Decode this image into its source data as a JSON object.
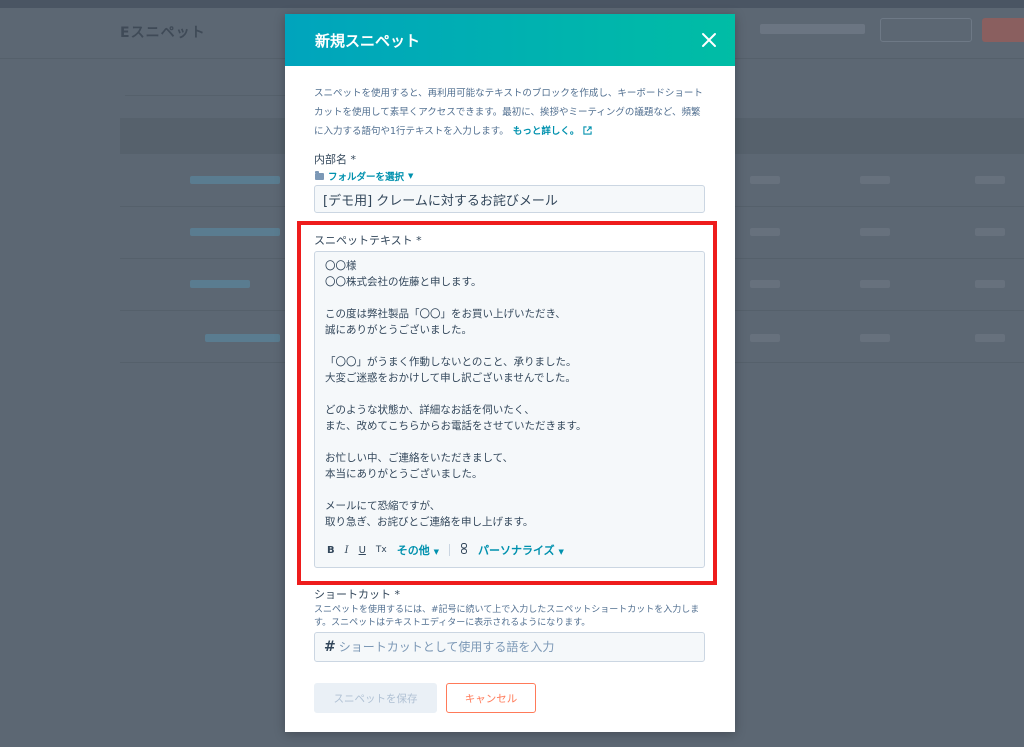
{
  "background": {
    "title": "Eスニペット"
  },
  "modal": {
    "title": "新規スニペット",
    "intro_text": "スニペットを使用すると、再利用可能なテキストのブロックを作成し、キーボードショートカットを使用して素早くアクセスできます。最初に、挨拶やミーティングの議題など、頻繁に入力する語句や1行テキストを入力します。",
    "learn_more": "もっと詳しく。",
    "internal_name_label": "内部名 *",
    "folder_select": "フォルダーを選択",
    "internal_name_value": "[デモ用] クレームに対するお詫びメール",
    "snippet_text_label": "スニペットテキスト *",
    "snippet_text": "〇〇様\n〇〇株式会社の佐藤と申します。\n\nこの度は弊社製品「〇〇」をお買い上げいただき、\n誠にありがとうございました。\n\n「〇〇」がうまく作動しないとのこと、承りました。\n大変ご迷惑をおかけして申し訳ございませんでした。\n\nどのような状態か、詳細なお話を伺いたく、\nまた、改めてこちらからお電話をさせていただきます。\n\nお忙しい中、ご連絡をいただきまして、\n本当にありがとうございました。\n\nメールにて恐縮ですが、\n取り急ぎ、お詫びとご連絡を申し上げます。",
    "toolbar": {
      "bold": "B",
      "italic": "I",
      "underline": "U",
      "clear_format": "Tx",
      "more": "その他",
      "personalize": "パーソナライズ"
    },
    "shortcut_label": "ショートカット *",
    "shortcut_help": "スニペットを使用するには、#記号に続いて上で入力したスニペットショートカットを入力します。スニペットはテキストエディターに表示されるようになります。",
    "shortcut_placeholder": "ショートカットとして使用する語を入力",
    "save_button": "スニペットを保存",
    "cancel_button": "キャンセル"
  },
  "colors": {
    "header_gradient_start": "#00a4bd",
    "header_gradient_end": "#00bda5",
    "link": "#0091ae",
    "highlight": "#ee1c1c",
    "cancel": "#ff7a59"
  }
}
